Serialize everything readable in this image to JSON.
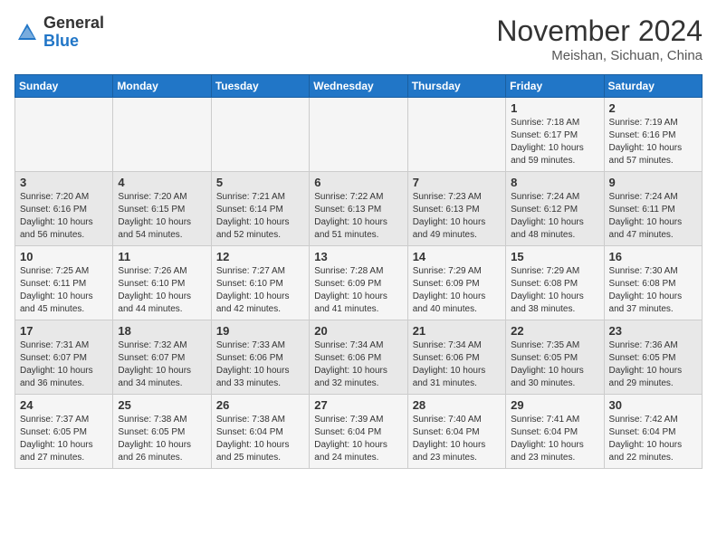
{
  "header": {
    "logo": {
      "line1": "General",
      "line2": "Blue"
    },
    "month": "November 2024",
    "location": "Meishan, Sichuan, China"
  },
  "weekdays": [
    "Sunday",
    "Monday",
    "Tuesday",
    "Wednesday",
    "Thursday",
    "Friday",
    "Saturday"
  ],
  "weeks": [
    [
      {
        "day": "",
        "info": ""
      },
      {
        "day": "",
        "info": ""
      },
      {
        "day": "",
        "info": ""
      },
      {
        "day": "",
        "info": ""
      },
      {
        "day": "",
        "info": ""
      },
      {
        "day": "1",
        "info": "Sunrise: 7:18 AM\nSunset: 6:17 PM\nDaylight: 10 hours\nand 59 minutes."
      },
      {
        "day": "2",
        "info": "Sunrise: 7:19 AM\nSunset: 6:16 PM\nDaylight: 10 hours\nand 57 minutes."
      }
    ],
    [
      {
        "day": "3",
        "info": "Sunrise: 7:20 AM\nSunset: 6:16 PM\nDaylight: 10 hours\nand 56 minutes."
      },
      {
        "day": "4",
        "info": "Sunrise: 7:20 AM\nSunset: 6:15 PM\nDaylight: 10 hours\nand 54 minutes."
      },
      {
        "day": "5",
        "info": "Sunrise: 7:21 AM\nSunset: 6:14 PM\nDaylight: 10 hours\nand 52 minutes."
      },
      {
        "day": "6",
        "info": "Sunrise: 7:22 AM\nSunset: 6:13 PM\nDaylight: 10 hours\nand 51 minutes."
      },
      {
        "day": "7",
        "info": "Sunrise: 7:23 AM\nSunset: 6:13 PM\nDaylight: 10 hours\nand 49 minutes."
      },
      {
        "day": "8",
        "info": "Sunrise: 7:24 AM\nSunset: 6:12 PM\nDaylight: 10 hours\nand 48 minutes."
      },
      {
        "day": "9",
        "info": "Sunrise: 7:24 AM\nSunset: 6:11 PM\nDaylight: 10 hours\nand 47 minutes."
      }
    ],
    [
      {
        "day": "10",
        "info": "Sunrise: 7:25 AM\nSunset: 6:11 PM\nDaylight: 10 hours\nand 45 minutes."
      },
      {
        "day": "11",
        "info": "Sunrise: 7:26 AM\nSunset: 6:10 PM\nDaylight: 10 hours\nand 44 minutes."
      },
      {
        "day": "12",
        "info": "Sunrise: 7:27 AM\nSunset: 6:10 PM\nDaylight: 10 hours\nand 42 minutes."
      },
      {
        "day": "13",
        "info": "Sunrise: 7:28 AM\nSunset: 6:09 PM\nDaylight: 10 hours\nand 41 minutes."
      },
      {
        "day": "14",
        "info": "Sunrise: 7:29 AM\nSunset: 6:09 PM\nDaylight: 10 hours\nand 40 minutes."
      },
      {
        "day": "15",
        "info": "Sunrise: 7:29 AM\nSunset: 6:08 PM\nDaylight: 10 hours\nand 38 minutes."
      },
      {
        "day": "16",
        "info": "Sunrise: 7:30 AM\nSunset: 6:08 PM\nDaylight: 10 hours\nand 37 minutes."
      }
    ],
    [
      {
        "day": "17",
        "info": "Sunrise: 7:31 AM\nSunset: 6:07 PM\nDaylight: 10 hours\nand 36 minutes."
      },
      {
        "day": "18",
        "info": "Sunrise: 7:32 AM\nSunset: 6:07 PM\nDaylight: 10 hours\nand 34 minutes."
      },
      {
        "day": "19",
        "info": "Sunrise: 7:33 AM\nSunset: 6:06 PM\nDaylight: 10 hours\nand 33 minutes."
      },
      {
        "day": "20",
        "info": "Sunrise: 7:34 AM\nSunset: 6:06 PM\nDaylight: 10 hours\nand 32 minutes."
      },
      {
        "day": "21",
        "info": "Sunrise: 7:34 AM\nSunset: 6:06 PM\nDaylight: 10 hours\nand 31 minutes."
      },
      {
        "day": "22",
        "info": "Sunrise: 7:35 AM\nSunset: 6:05 PM\nDaylight: 10 hours\nand 30 minutes."
      },
      {
        "day": "23",
        "info": "Sunrise: 7:36 AM\nSunset: 6:05 PM\nDaylight: 10 hours\nand 29 minutes."
      }
    ],
    [
      {
        "day": "24",
        "info": "Sunrise: 7:37 AM\nSunset: 6:05 PM\nDaylight: 10 hours\nand 27 minutes."
      },
      {
        "day": "25",
        "info": "Sunrise: 7:38 AM\nSunset: 6:05 PM\nDaylight: 10 hours\nand 26 minutes."
      },
      {
        "day": "26",
        "info": "Sunrise: 7:38 AM\nSunset: 6:04 PM\nDaylight: 10 hours\nand 25 minutes."
      },
      {
        "day": "27",
        "info": "Sunrise: 7:39 AM\nSunset: 6:04 PM\nDaylight: 10 hours\nand 24 minutes."
      },
      {
        "day": "28",
        "info": "Sunrise: 7:40 AM\nSunset: 6:04 PM\nDaylight: 10 hours\nand 23 minutes."
      },
      {
        "day": "29",
        "info": "Sunrise: 7:41 AM\nSunset: 6:04 PM\nDaylight: 10 hours\nand 23 minutes."
      },
      {
        "day": "30",
        "info": "Sunrise: 7:42 AM\nSunset: 6:04 PM\nDaylight: 10 hours\nand 22 minutes."
      }
    ]
  ]
}
